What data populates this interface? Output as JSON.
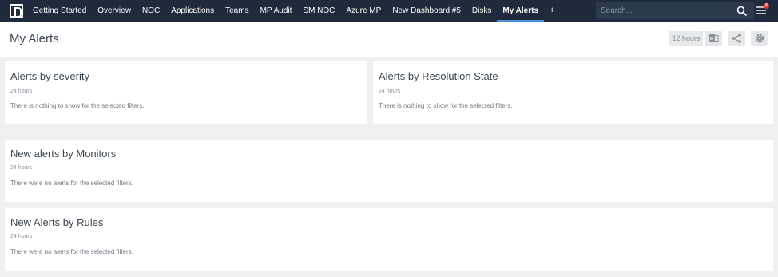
{
  "nav": {
    "items": [
      "Getting Started",
      "Overview",
      "NOC",
      "Applications",
      "Teams",
      "MP Audit",
      "SM NOC",
      "Azure MP",
      "New Dashboard #5",
      "Disks",
      "My Alerts"
    ],
    "active": "My Alerts",
    "add_label": "+",
    "search_placeholder": "Search...",
    "notification_count": "6"
  },
  "header": {
    "title": "My Alerts",
    "time_range": "12 hours"
  },
  "cards": [
    {
      "title": "Alerts by severity",
      "subtitle": "24 hours",
      "message": "There is nothing to show for the selected filters."
    },
    {
      "title": "Alerts by Resolution State",
      "subtitle": "24 hours",
      "message": "There is nothing to show for the selected filters."
    },
    {
      "title": "New alerts by Monitors",
      "subtitle": "24 hours",
      "message": "There were no alerts for the selected filters."
    },
    {
      "title": "New Alerts by Rules",
      "subtitle": "24 hours",
      "message": "There were no alerts for the selected filters."
    }
  ],
  "colors": {
    "nav_background": "#1f2a3c",
    "accent": "#4a90d9",
    "page_background": "#eef0f2",
    "badge": "#e03a3a"
  },
  "icons": [
    "logo-icon",
    "search-icon",
    "menu-icon",
    "excel-icon",
    "share-icon",
    "gear-icon"
  ]
}
